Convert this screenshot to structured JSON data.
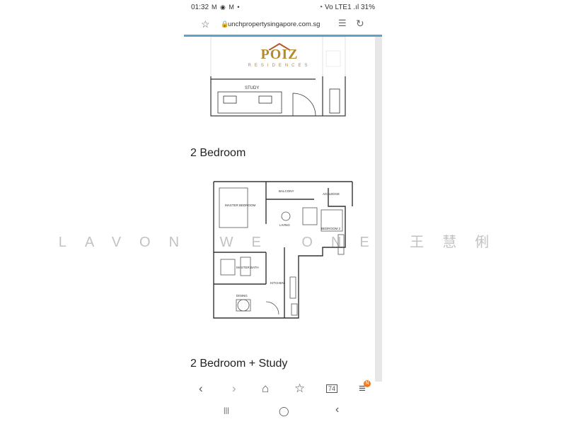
{
  "status_bar": {
    "time": "01:32",
    "notifications": "M ◉ M •",
    "right": "◔ Vo LTE1 .ıl 31%"
  },
  "address_bar": {
    "url": "unchpropertysingapore.com.sg",
    "star_icon": "star-icon",
    "reader_icon": "reader-icon",
    "reload_icon": "reload-icon"
  },
  "logo": {
    "name": "POIZ",
    "sub": "RESIDENCES"
  },
  "floorplans": {
    "top_label": "STUDY",
    "section_2br": {
      "heading": "2 Bedroom",
      "rooms": {
        "balcony": "BALCONY",
        "ac_ledge": "A/C LEDGE",
        "master": "MASTER BEDROOM",
        "living": "LIVING",
        "bedroom2": "BEDROOM 2",
        "master_bath": "MASTER BATH",
        "kitchen": "KITCHEN",
        "dining": "DINING"
      }
    },
    "section_2brs_heading": "2 Bedroom + Study"
  },
  "watermark": "LAVON WE ONE 王慧俐",
  "bottom_nav": {
    "back": "‹",
    "forward": "›",
    "home": "⌂",
    "bookmark": "☆",
    "tabs": "74",
    "menu": "≡",
    "badge": "N"
  },
  "system_nav": {
    "recent": "|||",
    "home": "◯",
    "back": "‹"
  }
}
